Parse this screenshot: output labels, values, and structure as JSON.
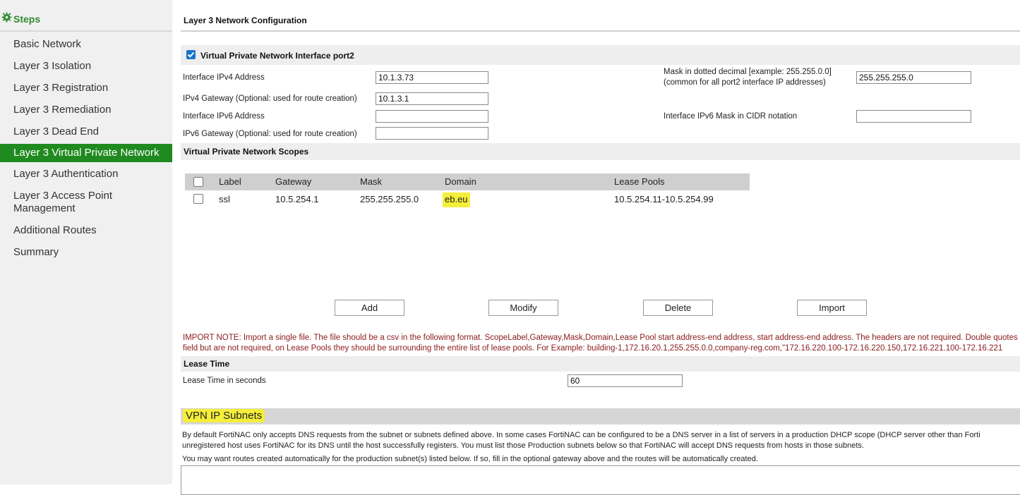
{
  "sidebar": {
    "header": "Steps",
    "items": [
      {
        "label": "Basic Network"
      },
      {
        "label": "Layer 3 Isolation"
      },
      {
        "label": "Layer 3 Registration"
      },
      {
        "label": "Layer 3 Remediation"
      },
      {
        "label": "Layer 3 Dead End"
      },
      {
        "label": "Layer 3 Virtual Private Network",
        "active": true
      },
      {
        "label": "Layer 3 Authentication"
      },
      {
        "label": "Layer 3 Access Point Management"
      },
      {
        "label": "Additional Routes"
      },
      {
        "label": "Summary"
      }
    ]
  },
  "main": {
    "title": "Layer 3 Network Configuration",
    "interface": {
      "checkbox_label": "Virtual Private Network Interface port2",
      "checked": true,
      "ipv4_label": "Interface IPv4 Address",
      "ipv4_value": "10.1.3.73",
      "gateway_label": "IPv4 Gateway (Optional: used for route creation)",
      "gateway_value": "10.1.3.1",
      "ipv6_label": "Interface IPv6 Address",
      "ipv6_value": "",
      "ipv6_gateway_label": "IPv6 Gateway (Optional: used for route creation)",
      "ipv6_gateway_value": "",
      "mask_label_line1": "Mask in dotted decimal [example: 255.255.0.0]",
      "mask_label_line2": "(common for all port2 interface IP addresses)",
      "mask_value": "255.255.255.0",
      "ipv6_mask_label": "Interface IPv6 Mask in CIDR notation",
      "ipv6_mask_value": ""
    },
    "scopes": {
      "title": "Virtual Private Network Scopes",
      "columns": [
        "Label",
        "Gateway",
        "Mask",
        "Domain",
        "Lease Pools"
      ],
      "rows": [
        {
          "label": "ssl",
          "gateway": "10.5.254.1",
          "mask": "255.255.255.0",
          "domain": "eb.eu",
          "lease_pools": "10.5.254.11-10.5.254.99"
        }
      ],
      "buttons": {
        "add": "Add",
        "modify": "Modify",
        "delete": "Delete",
        "import": "Import"
      }
    },
    "import_note_line1": "IMPORT NOTE: Import a single file. The file should be a csv in the following format. ScopeLabel,Gateway,Mask,Domain,Lease Pool start address-end address, start address-end address. The headers are not required. Double quotes",
    "import_note_line2": "field but are not required, on Lease Pools they should be surrounding the entire list of lease pools. For Example: building-1,172.16.20.1,255.255.0.0,company-reg.com,\"172.16.220.100-172.16.220.150,172.16.221.100-172.16.221",
    "lease": {
      "title": "Lease Time",
      "label": "Lease Time in seconds",
      "value": "60"
    },
    "vpn_subnets": {
      "title": "VPN IP Subnets",
      "desc_line1": "By default FortiNAC only accepts DNS requests from the subnet or subnets defined above. In some cases FortiNAC can be configured to be a DNS server in a list of servers in a production DHCP scope (DHCP server other than Forti",
      "desc_line2": "unregistered host uses FortiNAC for its DNS until the host successfully registers. You must list those Production subnets below so that FortiNAC will accept DNS requests from hosts in those subnets.",
      "desc_line3": "You may want routes created automatically for the production subnet(s) listed below. If so, fill in the optional gateway above and the routes will be automatically created."
    }
  },
  "colors": {
    "accent_green": "#1f8a1f",
    "highlight_yellow": "#f5ee3a",
    "note_red": "#8b1a1a",
    "checkbox_blue": "#1a73c8"
  }
}
